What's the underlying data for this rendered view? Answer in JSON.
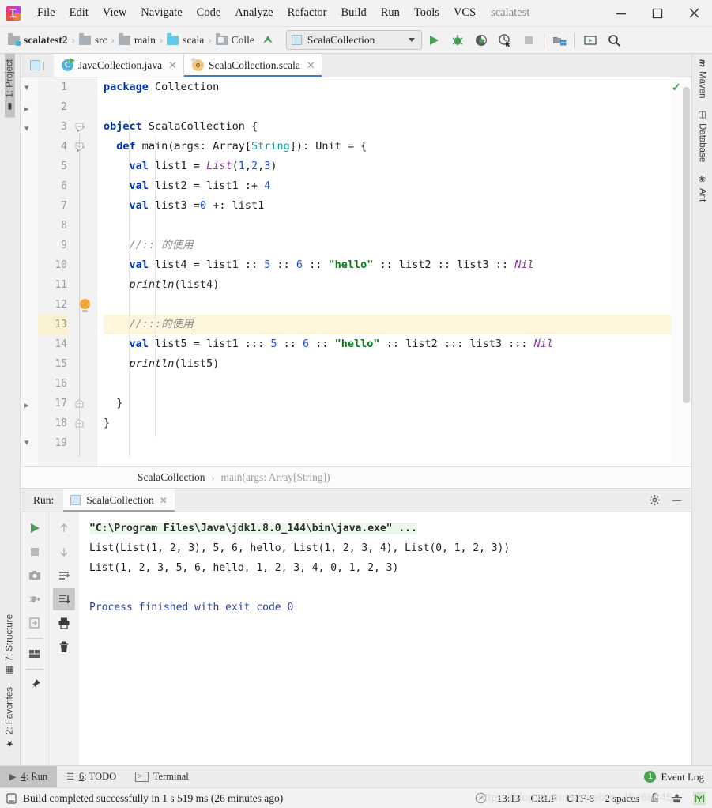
{
  "window": {
    "project_name": "scalatest",
    "menu": [
      {
        "label": "File",
        "mnemonic": "F"
      },
      {
        "label": "Edit",
        "mnemonic": "E"
      },
      {
        "label": "View",
        "mnemonic": "V"
      },
      {
        "label": "Navigate",
        "mnemonic": "N"
      },
      {
        "label": "Code",
        "mnemonic": "C"
      },
      {
        "label": "Analyze",
        "mnemonic": "z"
      },
      {
        "label": "Refactor",
        "mnemonic": "R"
      },
      {
        "label": "Build",
        "mnemonic": "B"
      },
      {
        "label": "Run",
        "mnemonic": "u"
      },
      {
        "label": "Tools",
        "mnemonic": "T"
      },
      {
        "label": "VCS",
        "mnemonic": "S"
      }
    ],
    "controls": {
      "minimize": "—",
      "maximize": "☐",
      "close": "✕"
    }
  },
  "navbar": {
    "breadcrumbs": [
      "scalatest2",
      "src",
      "main",
      "scala",
      "Colle"
    ],
    "run_config": "ScalaCollection",
    "buttons": [
      "run-button",
      "debug-button",
      "run-coverage-button",
      "profile-button",
      "stop-button",
      "build-project-button",
      "update-project-button",
      "search-everywhere-button"
    ]
  },
  "left_tools": [
    {
      "label": "1: Project",
      "icon": "folder-icon",
      "selected": true
    },
    {
      "label": "7: Structure",
      "icon": "structure-icon",
      "selected": false
    },
    {
      "label": "2: Favorites",
      "icon": "star-icon",
      "selected": false
    }
  ],
  "right_tools": [
    {
      "label": "Maven",
      "icon": "maven-icon"
    },
    {
      "label": "Database",
      "icon": "database-icon"
    },
    {
      "label": "Ant",
      "icon": "ant-icon"
    }
  ],
  "tabs": [
    {
      "label": "JavaCollection.java",
      "icon": "java-class-icon",
      "active": false
    },
    {
      "label": "ScalaCollection.scala",
      "icon": "scala-object-icon",
      "active": true
    }
  ],
  "editor": {
    "line_count": 19,
    "highlight_line": 13,
    "caret_line": 13,
    "lines": [
      {
        "n": 1,
        "tokens": [
          {
            "t": "package ",
            "c": "kw"
          },
          {
            "t": "Collection",
            "c": "pl"
          }
        ]
      },
      {
        "n": 2,
        "tokens": []
      },
      {
        "n": 3,
        "tokens": [
          {
            "t": "object ",
            "c": "kw"
          },
          {
            "t": "ScalaCollection {",
            "c": "pl"
          }
        ],
        "run_marker": true,
        "fold": true
      },
      {
        "n": 4,
        "tokens": [
          {
            "t": "  ",
            "c": "pl"
          },
          {
            "t": "def ",
            "c": "kw"
          },
          {
            "t": "main(args: ",
            "c": "pl"
          },
          {
            "t": "Array",
            "c": "pl"
          },
          {
            "t": "[",
            "c": "pl"
          },
          {
            "t": "String",
            "c": "ty"
          },
          {
            "t": "]): Unit = {",
            "c": "pl"
          }
        ],
        "run_marker": true,
        "fold": true
      },
      {
        "n": 5,
        "tokens": [
          {
            "t": "    ",
            "c": "pl"
          },
          {
            "t": "val ",
            "c": "kw"
          },
          {
            "t": "list1 = ",
            "c": "pl"
          },
          {
            "t": "List",
            "c": "cls"
          },
          {
            "t": "(",
            "c": "pl"
          },
          {
            "t": "1",
            "c": "num"
          },
          {
            "t": ",",
            "c": "pl"
          },
          {
            "t": "2",
            "c": "num"
          },
          {
            "t": ",",
            "c": "pl"
          },
          {
            "t": "3",
            "c": "num"
          },
          {
            "t": ")",
            "c": "pl"
          }
        ]
      },
      {
        "n": 6,
        "tokens": [
          {
            "t": "    ",
            "c": "pl"
          },
          {
            "t": "val ",
            "c": "kw"
          },
          {
            "t": "list2 = list1 :+ ",
            "c": "pl"
          },
          {
            "t": "4",
            "c": "num"
          }
        ]
      },
      {
        "n": 7,
        "tokens": [
          {
            "t": "    ",
            "c": "pl"
          },
          {
            "t": "val ",
            "c": "kw"
          },
          {
            "t": "list3 =",
            "c": "pl"
          },
          {
            "t": "0",
            "c": "num"
          },
          {
            "t": " +: list1",
            "c": "pl"
          }
        ]
      },
      {
        "n": 8,
        "tokens": []
      },
      {
        "n": 9,
        "tokens": [
          {
            "t": "    ",
            "c": "pl"
          },
          {
            "t": "//:: 的使用",
            "c": "cmt"
          }
        ]
      },
      {
        "n": 10,
        "tokens": [
          {
            "t": "    ",
            "c": "pl"
          },
          {
            "t": "val ",
            "c": "kw"
          },
          {
            "t": "list4 = list1 :: ",
            "c": "pl"
          },
          {
            "t": "5",
            "c": "num"
          },
          {
            "t": " :: ",
            "c": "pl"
          },
          {
            "t": "6",
            "c": "num"
          },
          {
            "t": " :: ",
            "c": "pl"
          },
          {
            "t": "\"hello\"",
            "c": "str"
          },
          {
            "t": " :: list2 :: list3 :: ",
            "c": "pl"
          },
          {
            "t": "Nil",
            "c": "cls"
          }
        ]
      },
      {
        "n": 11,
        "tokens": [
          {
            "t": "    ",
            "c": "pl"
          },
          {
            "t": "println",
            "c": "fn"
          },
          {
            "t": "(list4)",
            "c": "pl"
          }
        ]
      },
      {
        "n": 12,
        "tokens": [],
        "bulb": true
      },
      {
        "n": 13,
        "tokens": [
          {
            "t": "    ",
            "c": "pl"
          },
          {
            "t": "//:::的使用",
            "c": "cmt"
          }
        ],
        "caret": true
      },
      {
        "n": 14,
        "tokens": [
          {
            "t": "    ",
            "c": "pl"
          },
          {
            "t": "val ",
            "c": "kw"
          },
          {
            "t": "list5 = list1 ::: ",
            "c": "pl"
          },
          {
            "t": "5",
            "c": "num"
          },
          {
            "t": " :: ",
            "c": "pl"
          },
          {
            "t": "6",
            "c": "num"
          },
          {
            "t": " :: ",
            "c": "pl"
          },
          {
            "t": "\"hello\"",
            "c": "str"
          },
          {
            "t": " :: list2 ::: list3 ::: ",
            "c": "pl"
          },
          {
            "t": "Nil",
            "c": "cls"
          }
        ]
      },
      {
        "n": 15,
        "tokens": [
          {
            "t": "    ",
            "c": "pl"
          },
          {
            "t": "println",
            "c": "fn"
          },
          {
            "t": "(list5)",
            "c": "pl"
          }
        ]
      },
      {
        "n": 16,
        "tokens": []
      },
      {
        "n": 17,
        "tokens": [
          {
            "t": "  }",
            "c": "pl"
          }
        ],
        "fold_end": true
      },
      {
        "n": 18,
        "tokens": [
          {
            "t": "}",
            "c": "pl"
          }
        ],
        "fold_end": true
      },
      {
        "n": 19,
        "tokens": []
      }
    ],
    "inspection_status": "ok-check",
    "breadcrumb": {
      "class": "ScalaCollection",
      "separator": "›",
      "method": "main(args: Array[String])"
    }
  },
  "run_panel": {
    "label": "Run:",
    "tab": "ScalaCollection",
    "header_buttons": [
      "settings-gear-icon",
      "minimize-icon"
    ],
    "left_tools": [
      "rerun-icon",
      "stop-icon",
      "screenshot-icon",
      "dump-threads-icon",
      "console-icon",
      "layout-icon",
      "pin-icon"
    ],
    "right_tools": [
      "scroll-up-icon",
      "scroll-down-icon",
      "soft-wrap-icon",
      "scroll-to-end-icon",
      "print-icon",
      "trash-icon"
    ],
    "console": [
      {
        "text": "\"C:\\Program Files\\Java\\jdk1.8.0_144\\bin\\java.exe\" ...",
        "style": "cmd"
      },
      {
        "text": "List(List(1, 2, 3), 5, 6, hello, List(1, 2, 3, 4), List(0, 1, 2, 3))",
        "style": "out"
      },
      {
        "text": "List(1, 2, 3, 5, 6, hello, 1, 2, 3, 4, 0, 1, 2, 3)",
        "style": "out"
      },
      {
        "text": "",
        "style": "out"
      },
      {
        "text": "Process finished with exit code 0",
        "style": "blue"
      }
    ]
  },
  "bottom_bar": {
    "items": [
      {
        "label": "4: Run",
        "mnemonic": "4",
        "icon": "run-icon",
        "selected": true
      },
      {
        "label": "6: TODO",
        "mnemonic": "6",
        "icon": "todo-icon",
        "selected": false
      },
      {
        "label": "Terminal",
        "mnemonic": "",
        "icon": "terminal-icon",
        "selected": false
      }
    ],
    "event_log": {
      "label": "Event Log",
      "count": "1"
    }
  },
  "status_bar": {
    "message": "Build completed successfully in 1 s 519 ms (26 minutes ago)",
    "time": "13:13",
    "line_separator": "CRLF",
    "encoding": "UTF-8",
    "indent": "2 spaces",
    "icons": [
      "lock-icon",
      "inspector-icon",
      "hector-icon"
    ],
    "watermark": "https://blog.csdn.net/weixin_45468845"
  },
  "colors": {
    "accent": "#3c7dbf",
    "run_green": "#499c54",
    "keyword": "#0033b3",
    "string": "#067d17",
    "number": "#1750eb",
    "comment": "#8c8c8c",
    "class": "#8c2fa5",
    "type": "#20999d",
    "highlight_row": "#fdf6dd"
  }
}
